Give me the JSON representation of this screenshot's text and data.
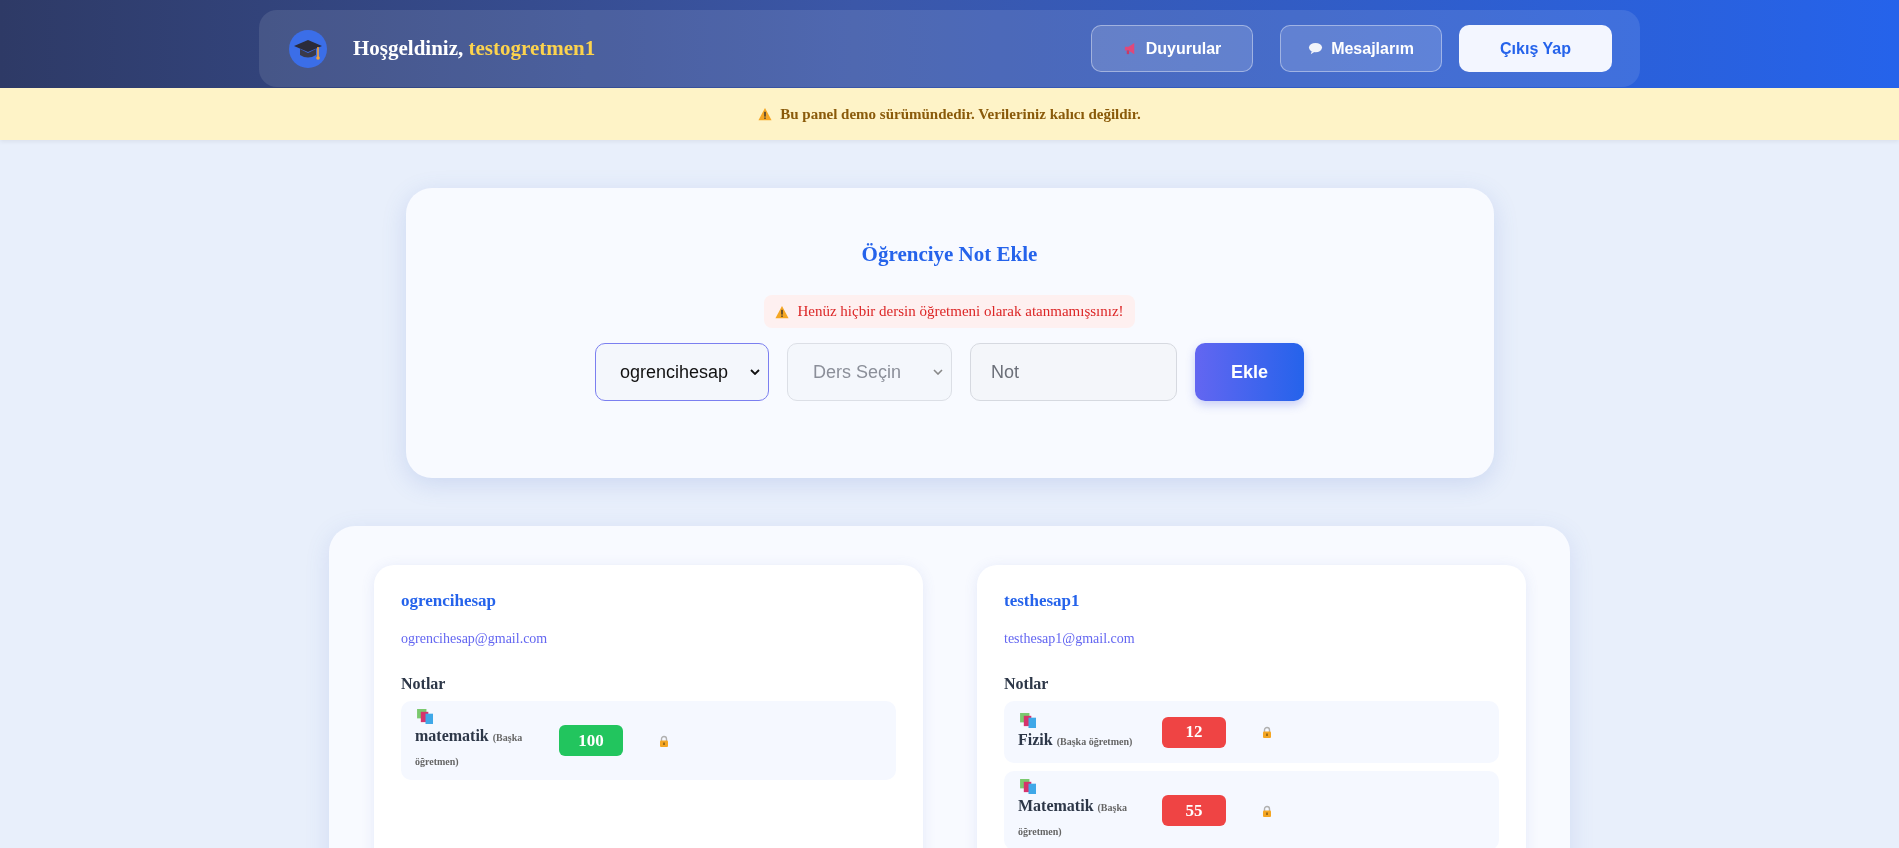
{
  "header": {
    "greeting": "Hoşgeldiniz,",
    "username": "testogretmen1",
    "buttons": [
      {
        "label": "Duyurular",
        "kind": "announce"
      },
      {
        "label": "Mesajlarım",
        "kind": "message"
      },
      {
        "label": "Çıkış Yap",
        "kind": "logout"
      }
    ]
  },
  "notice": "Bu panel demo sürümündedir. Verileriniz kalıcı değildir.",
  "form": {
    "title": "Öğrenciye Not Ekle",
    "alert": "Henüz hiçbir dersin öğretmeni olarak atanmamışsınız!",
    "student_select": {
      "value": "ogrencihesap",
      "disabled": false
    },
    "course_select": {
      "placeholder": "Ders Seçin",
      "disabled": true
    },
    "grade_input": {
      "placeholder": "Not"
    },
    "submit": "Ekle"
  },
  "students": [
    {
      "name": "ogrencihesap",
      "email": "ogrencihesap@gmail.com",
      "notes_title": "Notlar",
      "grades": [
        {
          "subject": "matematik",
          "note": "(Başka öğretmen)",
          "grade": "100",
          "color": "#22c55e",
          "locked": true
        }
      ]
    },
    {
      "name": "testhesap1",
      "email": "testhesap1@gmail.com",
      "notes_title": "Notlar",
      "grades": [
        {
          "subject": "Fizik",
          "note": "(Başka öğretmen)",
          "grade": "12",
          "color": "#ef4444",
          "locked": true
        },
        {
          "subject": "Matematik",
          "note": "(Başka öğretmen)",
          "grade": "55",
          "color": "#ef4444",
          "locked": true
        }
      ]
    }
  ]
}
